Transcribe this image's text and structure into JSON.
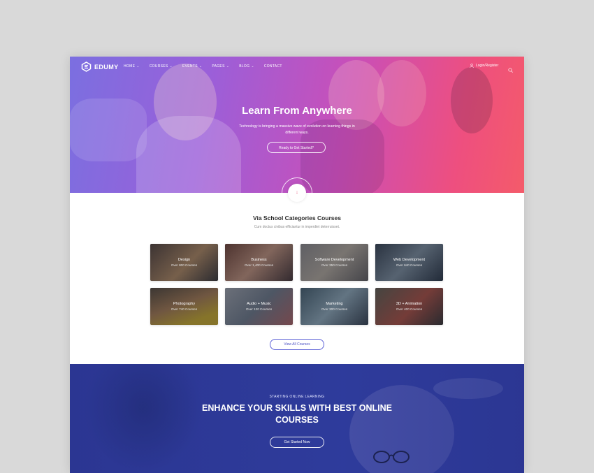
{
  "brand": {
    "name": "EDUMY"
  },
  "nav": {
    "items": [
      {
        "label": "HOME",
        "has_dropdown": true
      },
      {
        "label": "COURSES",
        "has_dropdown": true
      },
      {
        "label": "EVENTS",
        "has_dropdown": true
      },
      {
        "label": "PAGES",
        "has_dropdown": true
      },
      {
        "label": "BLOG",
        "has_dropdown": true
      },
      {
        "label": "CONTACT",
        "has_dropdown": false
      }
    ],
    "login_label": "Login/Register",
    "user_icon": "user-icon",
    "search_icon": "search-icon"
  },
  "hero": {
    "title": "Learn From Anywhere",
    "subtitle": "Technology is bringing a massive wave of evolution on learning things in different ways.",
    "button_label": "Ready to Get Started?",
    "scroll_icon": "arrow-down-icon"
  },
  "categories": {
    "title": "Via School Categories Courses",
    "subtitle": "Cum doctus civibus efficiantur in imperdiet deterruisset.",
    "items": [
      {
        "name": "Design",
        "count": "Over 800 Courses"
      },
      {
        "name": "Business",
        "count": "Over 1,400 Courses"
      },
      {
        "name": "Software Development",
        "count": "Over 350 Courses"
      },
      {
        "name": "Web Development",
        "count": "Over 640 Courses"
      },
      {
        "name": "Photography",
        "count": "Over 740 Courses"
      },
      {
        "name": "Audio + Music",
        "count": "Over 120 Courses"
      },
      {
        "name": "Marketing",
        "count": "Over 300 Courses"
      },
      {
        "name": "3D + Animation",
        "count": "Over 400 Courses"
      }
    ],
    "view_all_label": "View All Courses"
  },
  "cta": {
    "kicker": "STARTING ONLINE LEARNING",
    "title": "ENHANCE YOUR SKILLS WITH BEST ONLINE COURSES",
    "button_label": "Get Started Now"
  },
  "colors": {
    "hero_start": "#7b6fe0",
    "hero_end": "#f45b6a",
    "accent": "#5a5fd6",
    "cta_bg": "#2f3b9a"
  }
}
